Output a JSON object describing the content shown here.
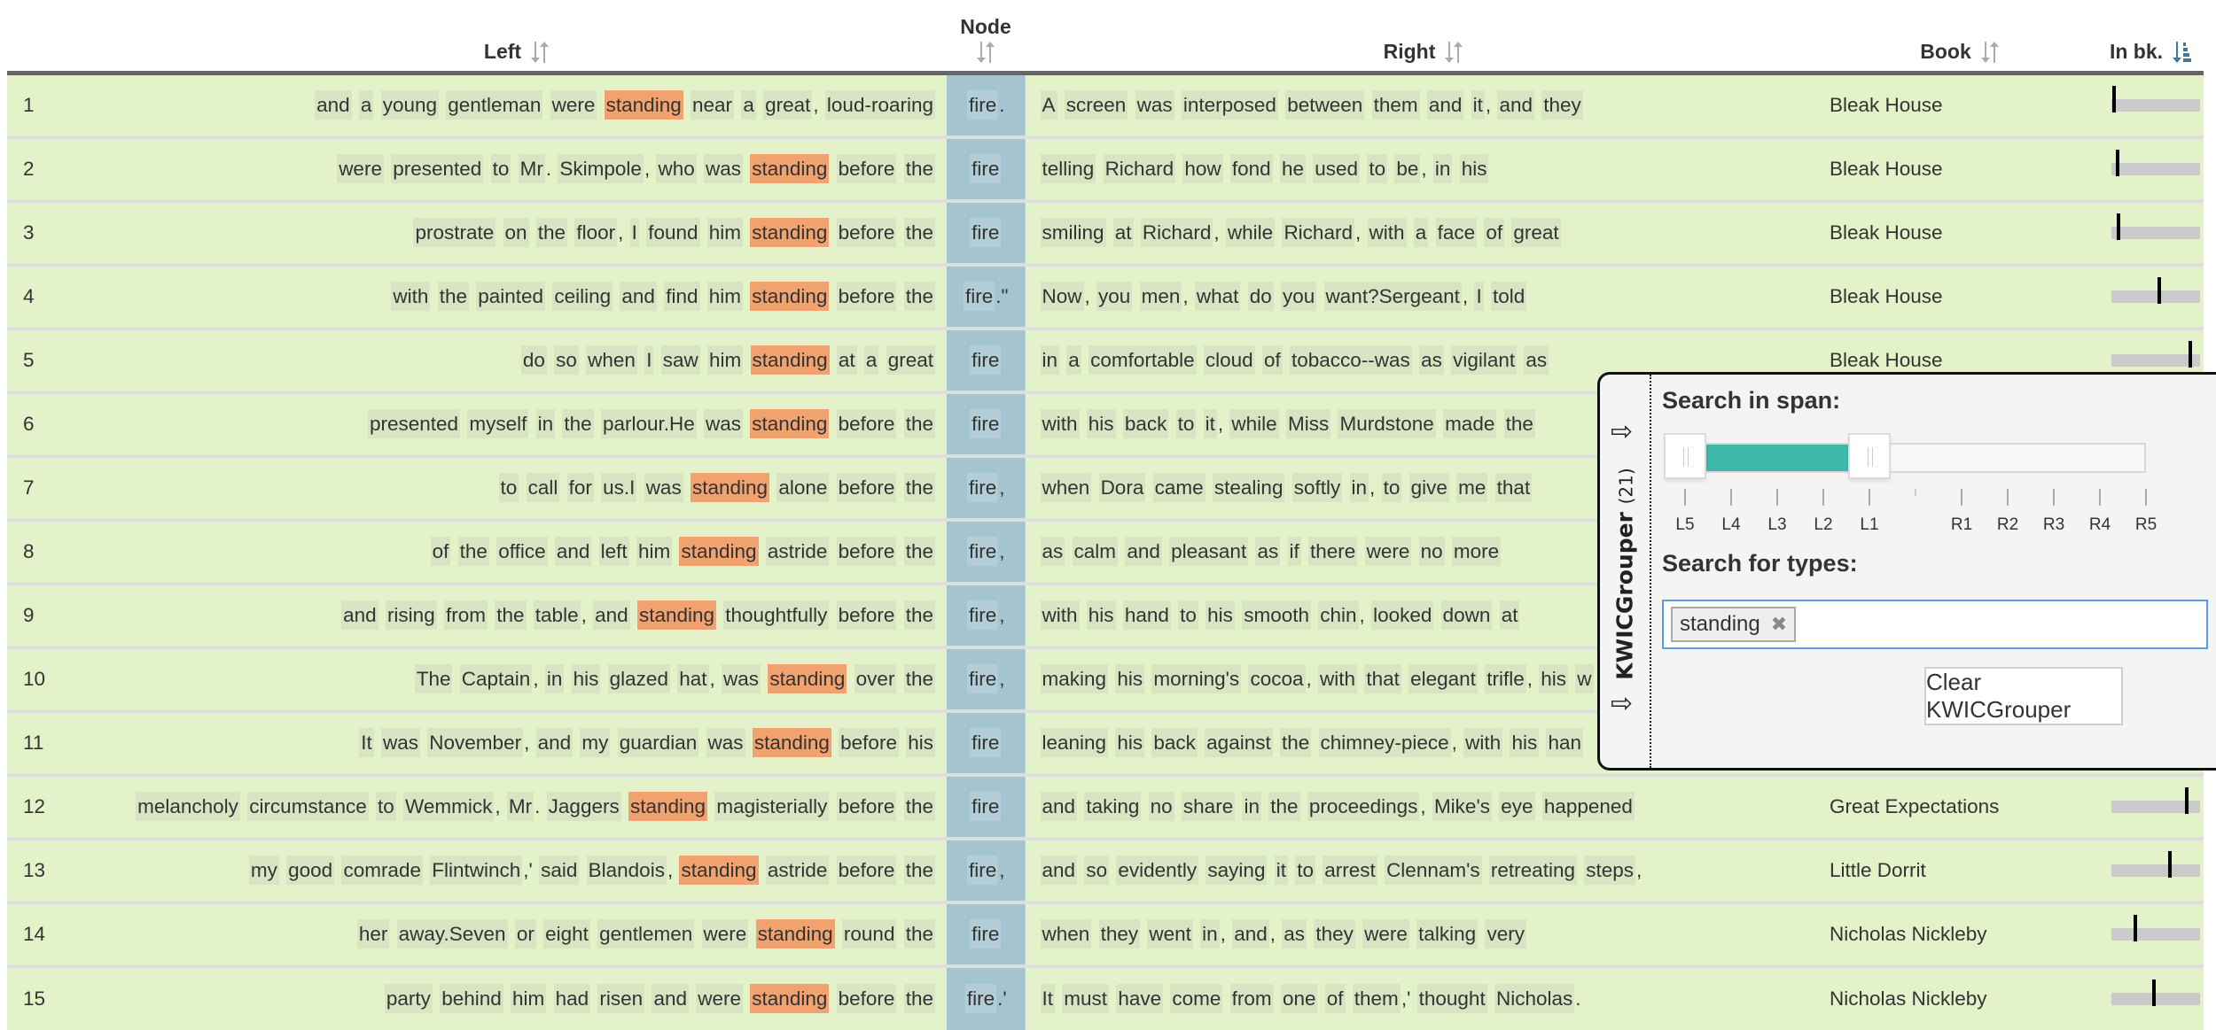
{
  "columns": {
    "num": "",
    "left": "Left",
    "node": "Node",
    "right": "Right",
    "book": "Book",
    "in_bk": "In bk."
  },
  "sort_state": {
    "left": "unsorted",
    "node": "unsorted",
    "right": "unsorted",
    "book": "unsorted",
    "in_bk": "ascending"
  },
  "colors": {
    "row_bg": "#e4f2ca",
    "node_bg": "#a4c4d0",
    "highlight": "#f2a26e",
    "slider_fill": "#3fb8ac",
    "sort_active": "#3d7a99"
  },
  "rows": [
    {
      "n": "1",
      "left": [
        "and",
        "a",
        "young",
        "gentleman",
        "were",
        "*standing",
        "near",
        "a",
        "great,",
        "loud-roaring"
      ],
      "node": "fire.",
      "right": [
        "A",
        "screen",
        "was",
        "interposed",
        "between",
        "them",
        "and",
        "it,",
        "and",
        "they"
      ],
      "book": "Bleak House",
      "in_bk": 0.03
    },
    {
      "n": "2",
      "left": [
        "were",
        "presented",
        "to",
        "Mr.",
        "Skimpole,",
        "who",
        "was",
        "*standing",
        "before",
        "the"
      ],
      "node": "fire",
      "right": [
        "telling",
        "Richard",
        "how",
        "fond",
        "he",
        "used",
        "to",
        "be,",
        "in",
        "his"
      ],
      "book": "Bleak House",
      "in_bk": 0.07
    },
    {
      "n": "3",
      "left": [
        "prostrate",
        "on",
        "the",
        "floor,",
        "I",
        "found",
        "him",
        "*standing",
        "before",
        "the"
      ],
      "node": "fire",
      "right": [
        "smiling",
        "at",
        "Richard,",
        "while",
        "Richard,",
        "with",
        "a",
        "face",
        "of",
        "great"
      ],
      "book": "Bleak House",
      "in_bk": 0.08
    },
    {
      "n": "4",
      "left": [
        "with",
        "the",
        "painted",
        "ceiling",
        "and",
        "find",
        "him",
        "*standing",
        "before",
        "the"
      ],
      "node": "fire.\"",
      "right": [
        "Now,",
        "you",
        "men,",
        "what",
        "do",
        "you",
        "want?Sergeant,",
        "I",
        "told"
      ],
      "book": "Bleak House",
      "in_bk": 0.54
    },
    {
      "n": "5",
      "left": [
        "do",
        "so",
        "when",
        "I",
        "saw",
        "him",
        "*standing",
        "at",
        "a",
        "great"
      ],
      "node": "fire",
      "right": [
        "in",
        "a",
        "comfortable",
        "cloud",
        "of",
        "tobacco--was",
        "as",
        "vigilant",
        "as"
      ],
      "book": "Bleak House",
      "in_bk": 0.89
    },
    {
      "n": "6",
      "left": [
        "presented",
        "myself",
        "in",
        "the",
        "parlour.He",
        "was",
        "*standing",
        "before",
        "the"
      ],
      "node": "fire",
      "right": [
        "with",
        "his",
        "back",
        "to",
        "it,",
        "while",
        "Miss",
        "Murdstone",
        "made",
        "the"
      ],
      "book": "",
      "in_bk": null
    },
    {
      "n": "7",
      "left": [
        "to",
        "call",
        "for",
        "us.I",
        "was",
        "*standing",
        "alone",
        "before",
        "the"
      ],
      "node": "fire,",
      "right": [
        "when",
        "Dora",
        "came",
        "stealing",
        "softly",
        "in,",
        "to",
        "give",
        "me",
        "that"
      ],
      "book": "",
      "in_bk": null
    },
    {
      "n": "8",
      "left": [
        "of",
        "the",
        "office",
        "and",
        "left",
        "him",
        "*standing",
        "astride",
        "before",
        "the"
      ],
      "node": "fire,",
      "right": [
        "as",
        "calm",
        "and",
        "pleasant",
        "as",
        "if",
        "there",
        "were",
        "no",
        "more"
      ],
      "book": "",
      "in_bk": null
    },
    {
      "n": "9",
      "left": [
        "and",
        "rising",
        "from",
        "the",
        "table,",
        "and",
        "*standing",
        "thoughtfully",
        "before",
        "the"
      ],
      "node": "fire,",
      "right": [
        "with",
        "his",
        "hand",
        "to",
        "his",
        "smooth",
        "chin,",
        "looked",
        "down",
        "at"
      ],
      "book": "",
      "in_bk": null
    },
    {
      "n": "10",
      "left": [
        "The",
        "Captain,",
        "in",
        "his",
        "glazed",
        "hat,",
        "was",
        "*standing",
        "over",
        "the"
      ],
      "node": "fire,",
      "right": [
        "making",
        "his",
        "morning's",
        "cocoa,",
        "with",
        "that",
        "elegant",
        "trifle,",
        "his",
        "w"
      ],
      "book": "",
      "in_bk": null
    },
    {
      "n": "11",
      "left": [
        "It",
        "was",
        "November,",
        "and",
        "my",
        "guardian",
        "was",
        "*standing",
        "before",
        "his"
      ],
      "node": "fire",
      "right": [
        "leaning",
        "his",
        "back",
        "against",
        "the",
        "chimney-piece,",
        "with",
        "his",
        "han"
      ],
      "book": "",
      "in_bk": null
    },
    {
      "n": "12",
      "left": [
        "melancholy",
        "circumstance",
        "to",
        "Wemmick,",
        "Mr.",
        "Jaggers",
        "*standing",
        "magisterially",
        "before",
        "the"
      ],
      "node": "fire",
      "right": [
        "and",
        "taking",
        "no",
        "share",
        "in",
        "the",
        "proceedings,",
        "Mike's",
        "eye",
        "happened"
      ],
      "book": "Great Expectations",
      "in_bk": 0.85
    },
    {
      "n": "13",
      "left": [
        "my",
        "good",
        "comrade",
        "Flintwinch,'",
        "said",
        "Blandois,",
        "*standing",
        "astride",
        "before",
        "the"
      ],
      "node": "fire,",
      "right": [
        "and",
        "so",
        "evidently",
        "saying",
        "it",
        "to",
        "arrest",
        "Clennam's",
        "retreating",
        "steps,"
      ],
      "book": "Little Dorrit",
      "in_bk": 0.66
    },
    {
      "n": "14",
      "left": [
        "her",
        "away.Seven",
        "or",
        "eight",
        "gentlemen",
        "were",
        "*standing",
        "round",
        "the"
      ],
      "node": "fire",
      "right": [
        "when",
        "they",
        "went",
        "in,",
        "and,",
        "as",
        "they",
        "were",
        "talking",
        "very"
      ],
      "book": "Nicholas Nickleby",
      "in_bk": 0.27
    },
    {
      "n": "15",
      "left": [
        "party",
        "behind",
        "him",
        "had",
        "risen",
        "and",
        "were",
        "*standing",
        "before",
        "the"
      ],
      "node": "fire.'",
      "right": [
        "It",
        "must",
        "have",
        "come",
        "from",
        "one",
        "of",
        "them,'",
        "thought",
        "Nicholas."
      ],
      "book": "Nicholas Nickleby",
      "in_bk": 0.48
    }
  ],
  "kwicgrouper": {
    "tab_label": "KWICGrouper",
    "tab_count": "(21)",
    "span_label": "Search in span:",
    "span_ticks": [
      "L5",
      "L4",
      "L3",
      "L2",
      "L1",
      "",
      "R1",
      "R2",
      "R3",
      "R4",
      "R5"
    ],
    "span_selected": [
      "L5",
      "L1"
    ],
    "types_label": "Search for types:",
    "types": [
      "standing"
    ],
    "types_input_value": "",
    "clear_button": "Clear KWICGrouper"
  }
}
